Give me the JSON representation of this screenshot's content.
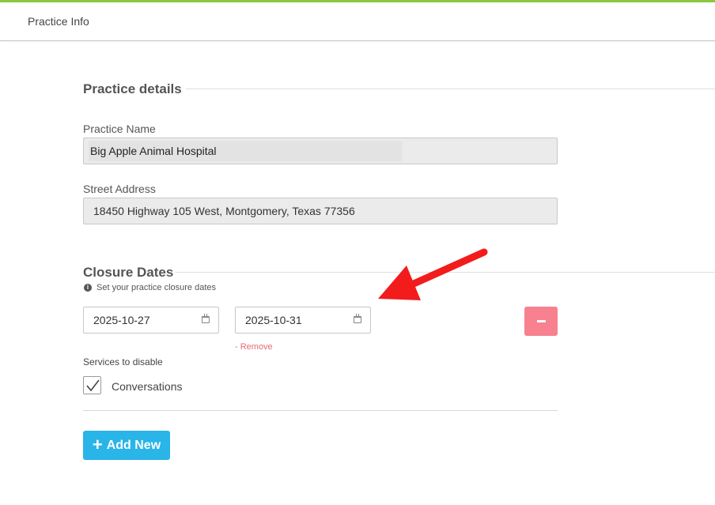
{
  "header": {
    "title": "Practice Info"
  },
  "practice_details": {
    "heading": "Practice details",
    "name_label": "Practice Name",
    "name_value": "Big Apple Animal Hospital",
    "address_label": "Street Address",
    "address_value": "18450 Highway 105 West, Montgomery, Texas 77356"
  },
  "closure": {
    "heading": "Closure Dates",
    "hint": "Set your practice closure dates",
    "start_date": "2025-10-27",
    "end_date": "2025-10-31",
    "remove_label": "- Remove",
    "services_label": "Services to disable",
    "services": [
      {
        "label": "Conversations",
        "checked": true
      }
    ]
  },
  "actions": {
    "add_new_label": "Add New"
  },
  "icons": {
    "info": "info-circle-icon",
    "calendar": "calendar-icon",
    "minus": "minus-icon",
    "check": "checkmark-icon",
    "plus": "plus-icon"
  },
  "colors": {
    "accent_bar": "#8cc63f",
    "remove_button": "#f7818f",
    "remove_link": "#e86a7b",
    "add_button": "#29b5e8",
    "annotation_arrow": "#f21c1c"
  }
}
